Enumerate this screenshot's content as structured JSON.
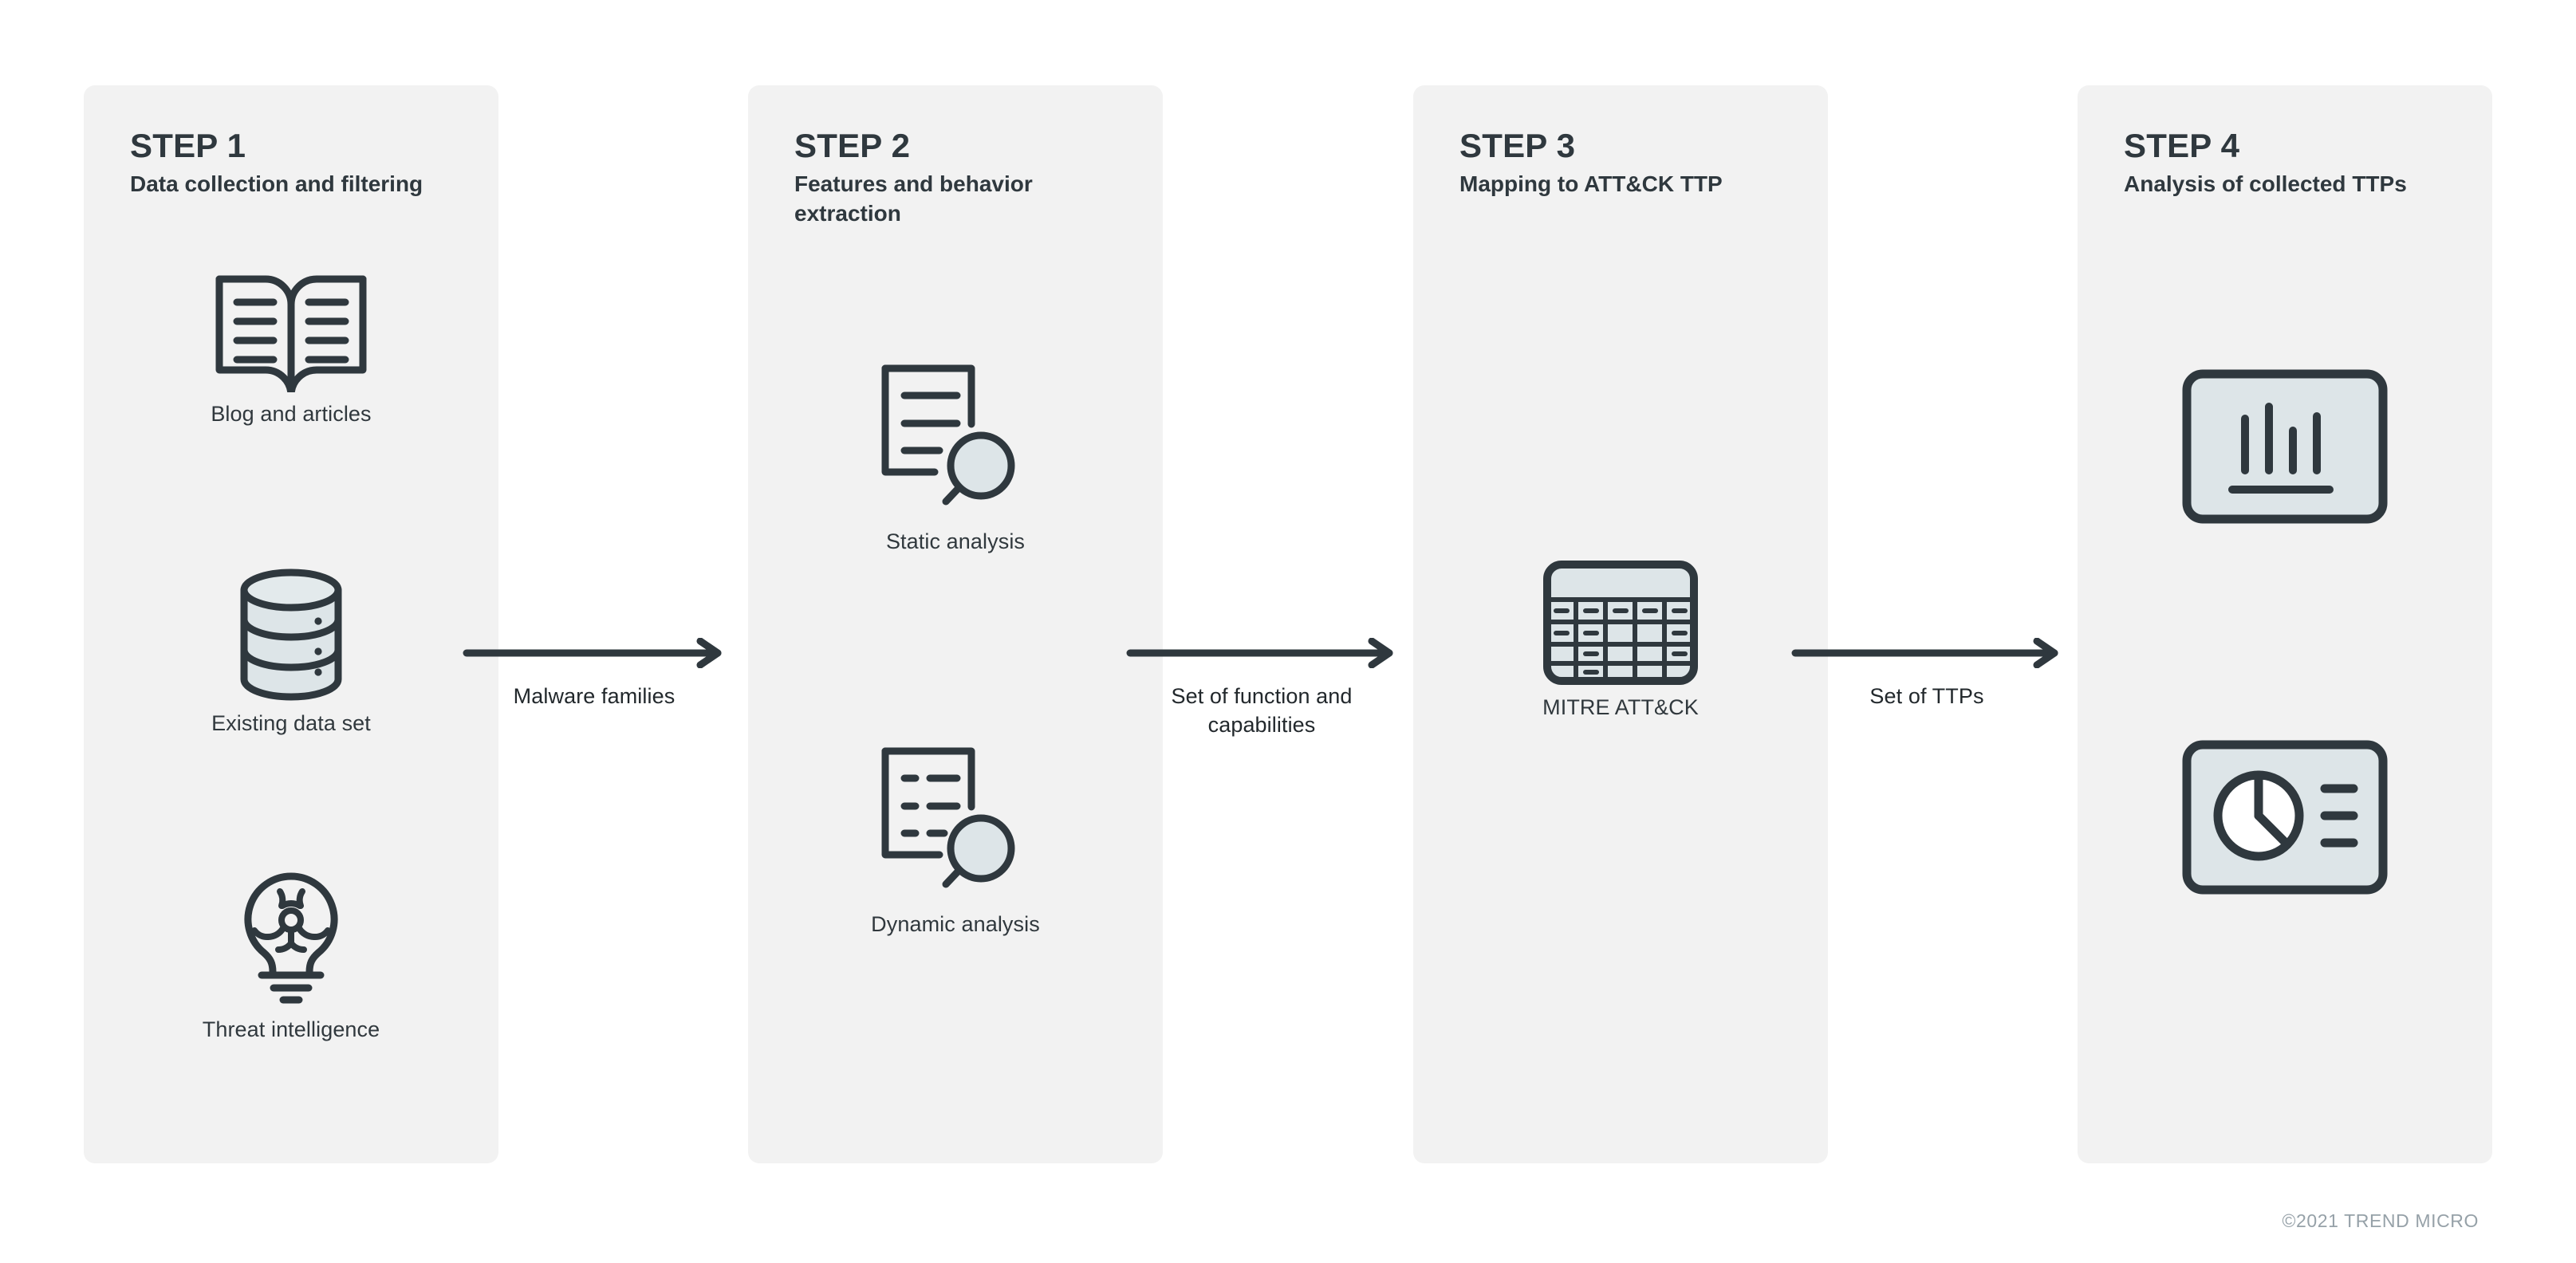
{
  "colors": {
    "panel_bg": "#f2f2f2",
    "page_bg": "#ffffff",
    "ink": "#2f383e",
    "icon_fill": "#dde5e8",
    "footer_text": "#96a1a8"
  },
  "steps": [
    {
      "id": "step-1",
      "title": "STEP 1",
      "subtitle": "Data collection and filtering",
      "items": [
        {
          "icon": "open-book-icon",
          "caption": "Blog and articles"
        },
        {
          "icon": "database-cylinder-icon",
          "caption": "Existing data set"
        },
        {
          "icon": "lightbulb-biohazard-icon",
          "caption": "Threat intelligence"
        }
      ]
    },
    {
      "id": "step-2",
      "title": "STEP 2",
      "subtitle": "Features and behavior extraction",
      "items": [
        {
          "icon": "document-magnifier-icon",
          "caption": "Static analysis"
        },
        {
          "icon": "document-dashed-magnifier-icon",
          "caption": "Dynamic analysis"
        }
      ]
    },
    {
      "id": "step-3",
      "title": "STEP 3",
      "subtitle": "Mapping to ATT&CK TTP",
      "items": [
        {
          "icon": "matrix-grid-icon",
          "caption": "MITRE ATT&CK"
        }
      ]
    },
    {
      "id": "step-4",
      "title": "STEP 4",
      "subtitle": "Analysis of collected TTPs",
      "items": [
        {
          "icon": "bar-chart-icon",
          "caption": ""
        },
        {
          "icon": "pie-chart-icon",
          "caption": ""
        }
      ]
    }
  ],
  "connectors": [
    {
      "id": "connector-1",
      "icon": "arrow-right-icon",
      "label": "Malware families"
    },
    {
      "id": "connector-2",
      "icon": "arrow-right-icon",
      "label": "Set of function and capabilities"
    },
    {
      "id": "connector-3",
      "icon": "arrow-right-icon",
      "label": "Set of TTPs"
    }
  ],
  "footer": {
    "copyright": "©2021 TREND MICRO"
  }
}
